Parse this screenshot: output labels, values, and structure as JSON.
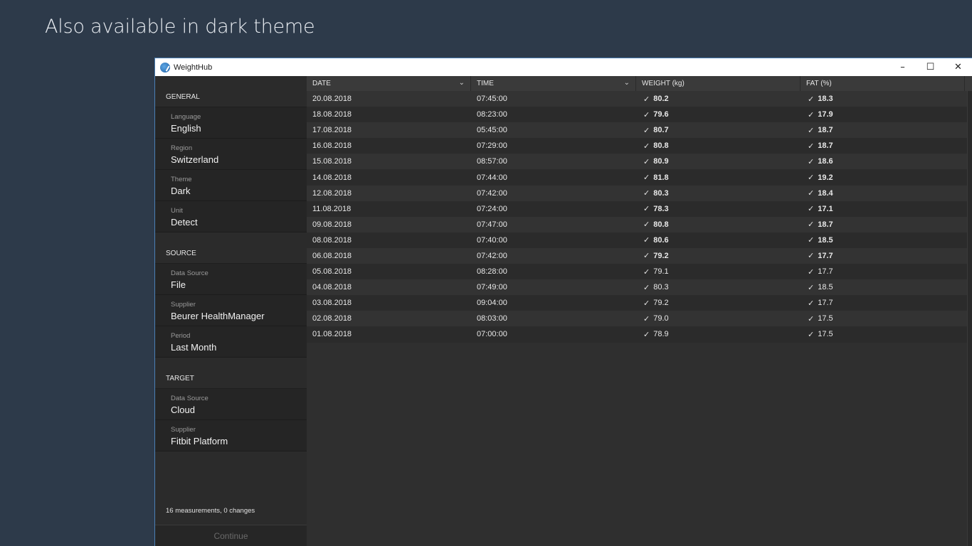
{
  "headline": "Also available in dark theme",
  "window": {
    "title": "WeightHub",
    "minimize": "–",
    "maximize": "☐",
    "close": "✕"
  },
  "sidebar": {
    "general": {
      "header": "GENERAL",
      "items": [
        {
          "label": "Language",
          "value": "English"
        },
        {
          "label": "Region",
          "value": "Switzerland"
        },
        {
          "label": "Theme",
          "value": "Dark"
        },
        {
          "label": "Unit",
          "value": "Detect"
        }
      ]
    },
    "source": {
      "header": "SOURCE",
      "items": [
        {
          "label": "Data Source",
          "value": "File"
        },
        {
          "label": "Supplier",
          "value": "Beurer HealthManager"
        },
        {
          "label": "Period",
          "value": "Last Month"
        }
      ]
    },
    "target": {
      "header": "TARGET",
      "items": [
        {
          "label": "Data Source",
          "value": "Cloud"
        },
        {
          "label": "Supplier",
          "value": "Fitbit Platform"
        }
      ]
    },
    "status": "16 measurements, 0 changes",
    "continue_label": "Continue"
  },
  "table": {
    "columns": [
      "DATE",
      "TIME",
      "WEIGHT (kg)",
      "FAT (%)"
    ],
    "rows": [
      {
        "date": "20.08.2018",
        "time": "07:45:00",
        "weight": "80.2",
        "fat": "18.3",
        "bold": true
      },
      {
        "date": "18.08.2018",
        "time": "08:23:00",
        "weight": "79.6",
        "fat": "17.9",
        "bold": true
      },
      {
        "date": "17.08.2018",
        "time": "05:45:00",
        "weight": "80.7",
        "fat": "18.7",
        "bold": true
      },
      {
        "date": "16.08.2018",
        "time": "07:29:00",
        "weight": "80.8",
        "fat": "18.7",
        "bold": true
      },
      {
        "date": "15.08.2018",
        "time": "08:57:00",
        "weight": "80.9",
        "fat": "18.6",
        "bold": true
      },
      {
        "date": "14.08.2018",
        "time": "07:44:00",
        "weight": "81.8",
        "fat": "19.2",
        "bold": true
      },
      {
        "date": "12.08.2018",
        "time": "07:42:00",
        "weight": "80.3",
        "fat": "18.4",
        "bold": true
      },
      {
        "date": "11.08.2018",
        "time": "07:24:00",
        "weight": "78.3",
        "fat": "17.1",
        "bold": true
      },
      {
        "date": "09.08.2018",
        "time": "07:47:00",
        "weight": "80.8",
        "fat": "18.7",
        "bold": true
      },
      {
        "date": "08.08.2018",
        "time": "07:40:00",
        "weight": "80.6",
        "fat": "18.5",
        "bold": true
      },
      {
        "date": "06.08.2018",
        "time": "07:42:00",
        "weight": "79.2",
        "fat": "17.7",
        "bold": true
      },
      {
        "date": "05.08.2018",
        "time": "08:28:00",
        "weight": "79.1",
        "fat": "17.7",
        "bold": false
      },
      {
        "date": "04.08.2018",
        "time": "07:49:00",
        "weight": "80.3",
        "fat": "18.5",
        "bold": false
      },
      {
        "date": "03.08.2018",
        "time": "09:04:00",
        "weight": "79.2",
        "fat": "17.7",
        "bold": false
      },
      {
        "date": "02.08.2018",
        "time": "08:03:00",
        "weight": "79.0",
        "fat": "17.5",
        "bold": false
      },
      {
        "date": "01.08.2018",
        "time": "07:00:00",
        "weight": "78.9",
        "fat": "17.5",
        "bold": false
      }
    ]
  }
}
